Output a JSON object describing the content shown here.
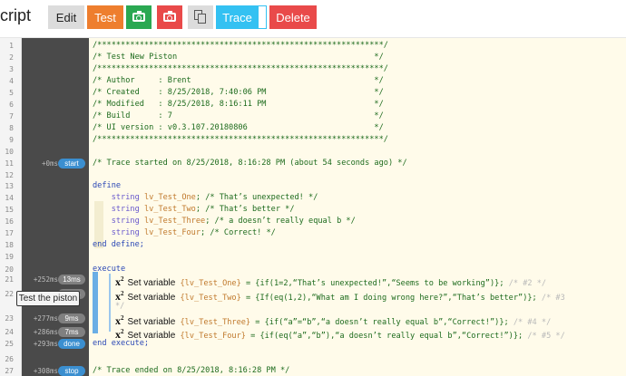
{
  "toolbar": {
    "title": "cript",
    "edit_label": "Edit",
    "test_label": "Test",
    "trace_label": "Trace",
    "delete_label": "Delete",
    "colors": {
      "test": "#ee7e2e",
      "green": "#2aa852",
      "red": "#e94a4a",
      "trace": "#33c1f2"
    }
  },
  "tooltip": "Test the piston",
  "lines": [
    {
      "n": "1",
      "code": "/*************************************************************/"
    },
    {
      "n": "2",
      "code": "/* Test New Piston                                          */"
    },
    {
      "n": "3",
      "code": "/*************************************************************/"
    },
    {
      "n": "4",
      "code": "/* Author     : Brent                                       */"
    },
    {
      "n": "5",
      "code": "/* Created    : 8/25/2018, 7:40:06 PM                       */"
    },
    {
      "n": "6",
      "code": "/* Modified   : 8/25/2018, 8:16:11 PM                       */"
    },
    {
      "n": "7",
      "code": "/* Build      : 7                                           */"
    },
    {
      "n": "8",
      "code": "/* UI version : v0.3.107.20180806                           */"
    },
    {
      "n": "9",
      "code": "/*************************************************************/"
    },
    {
      "n": "10",
      "code": ""
    },
    {
      "n": "11",
      "time": "+0ms",
      "badge": "start",
      "code": "/* Trace started on 8/25/2018, 8:16:28 PM (about 54 seconds ago) */"
    },
    {
      "n": "12",
      "code": ""
    },
    {
      "n": "13",
      "kw": "define"
    },
    {
      "n": "14",
      "type": "string",
      "var": "lv_Test_One",
      "rest": "; /* That’s unexpected! */"
    },
    {
      "n": "15",
      "type": "string",
      "var": "lv_Test_Two",
      "rest": "; /* That’s better */"
    },
    {
      "n": "16",
      "type": "string",
      "var": "lv_Test_Three",
      "rest": "; /* a doesn’t really equal b */"
    },
    {
      "n": "17",
      "type": "string",
      "var": "lv_Test_Four",
      "rest": "; /* Correct! */"
    },
    {
      "n": "18",
      "kw": "end define;"
    },
    {
      "n": "19",
      "code": ""
    },
    {
      "n": "20",
      "kw": "execute"
    },
    {
      "n": "21",
      "time": "+252ms",
      "badge": "13ms",
      "set_label": "Set variable",
      "var": "{lv_Test_One}",
      "expr": " = {if(1=2,“That’s unexpected!”,“Seems to be working”)};",
      "note": " /* #2 */"
    },
    {
      "n": "22",
      "time": "+265ms",
      "badge": "11ms",
      "set_label": "Set variable",
      "var": "{lv_Test_Two}",
      "expr": " = {If(eq(1,2),“What am I doing wrong here?”,“That’s better”)};",
      "note": " /* #3"
    },
    {
      "n": "",
      "note": "*/"
    },
    {
      "n": "23",
      "time": "+277ms",
      "badge": "9ms",
      "set_label": "Set variable",
      "var": "{lv_Test_Three}",
      "expr": " = {if(“a”=“b”,“a doesn’t really equal b”,“Correct!”)};",
      "note": " /* #4 */"
    },
    {
      "n": "24",
      "time": "+286ms",
      "badge": "7ms",
      "set_label": "Set variable",
      "var": "{lv_Test_Four}",
      "expr": " = {if(eq(“a”,“b”),“a doesn’t really equal b”,“Correct!”)};",
      "note": " /* #5 */"
    },
    {
      "n": "25",
      "time": "+293ms",
      "badge": "done",
      "kw": "end execute;"
    },
    {
      "n": "26",
      "code": ""
    },
    {
      "n": "27",
      "time": "+308ms",
      "badge": "stop",
      "code": "/* Trace ended on 8/25/2018, 8:16:28 PM */"
    }
  ]
}
